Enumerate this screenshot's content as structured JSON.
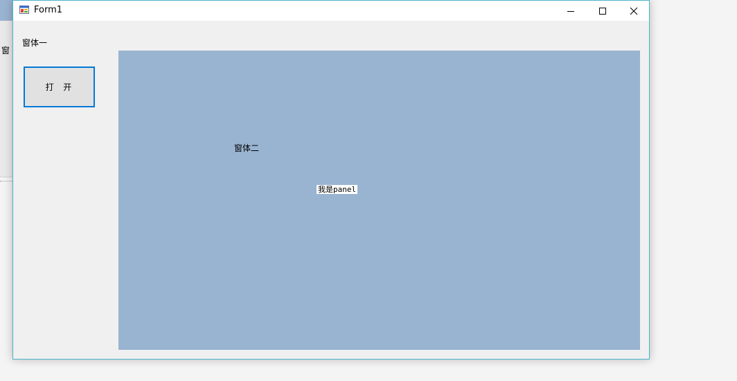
{
  "background_window": {
    "partial_label": "窗"
  },
  "window": {
    "title": "Form1",
    "controls": {
      "minimize": "—",
      "maximize": "☐",
      "close": "✕"
    }
  },
  "main": {
    "label1": "窗体一",
    "open_button": "打  开",
    "panel": {
      "color": "#99b4d1",
      "label2": "窗体二",
      "panel_label": "我是panel"
    }
  }
}
